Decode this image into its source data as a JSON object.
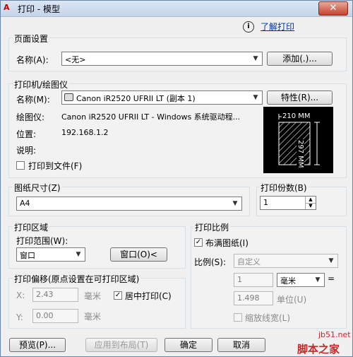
{
  "window": {
    "title": "打印 - 模型",
    "close_glyph": "✕"
  },
  "help": {
    "icon_glyph": "i",
    "link": "了解打印"
  },
  "page_setup": {
    "group_label": "页面设置",
    "name_label": "名称(A):",
    "name_value": "<无>",
    "add_button": "添加(.)..."
  },
  "printer": {
    "group_label": "打印机/绘图仪",
    "name_label": "名称(M):",
    "name_value": "Canon iR2520 UFRII LT (副本 1)",
    "properties_button": "特性(R)...",
    "plotter_label": "绘图仪:",
    "plotter_value": "Canon iR2520 UFRII LT - Windows 系统驱动程...",
    "location_label": "位置:",
    "location_value": "192.168.1.2",
    "description_label": "说明:",
    "print_to_file_label": "打印到文件(F)",
    "print_to_file_checked": false,
    "preview_width_label": "210 MM",
    "preview_height_label": "297 MM"
  },
  "paper_size": {
    "label": "图纸尺寸(Z)",
    "value": "A4"
  },
  "copies": {
    "label": "打印份数(B)",
    "value": "1"
  },
  "print_area": {
    "group_label": "打印区域",
    "range_label": "打印范围(W):",
    "range_value": "窗口",
    "window_button": "窗口(O)<"
  },
  "print_offset": {
    "group_label": "打印偏移(原点设置在可打印区域)",
    "x_label": "X:",
    "x_value": "2.43",
    "x_unit": "毫米",
    "y_label": "Y:",
    "y_value": "0.00",
    "y_unit": "毫米",
    "center_label": "居中打印(C)",
    "center_checked": true
  },
  "print_scale": {
    "group_label": "打印比例",
    "fit_label": "布满图纸(I)",
    "fit_checked": true,
    "scale_label": "比例(S):",
    "scale_value": "自定义",
    "value1": "1",
    "unit_value": "毫米",
    "equals": "=",
    "value2": "1.498",
    "unit2_label": "单位(U)",
    "lineweight_label": "缩放线宽(L)",
    "lineweight_checked": false
  },
  "footer": {
    "preview_button": "预览(P)...",
    "apply_button": "应用到布局(T)",
    "ok_button": "确定",
    "cancel_button": "取消"
  },
  "watermark": {
    "site": "jb51.net",
    "name": "脚本之家"
  },
  "colors": {
    "titlebar": "#c5d5ea",
    "dialog_bg": "#f0f0f0",
    "link": "#003399",
    "close_button": "#c7412c"
  }
}
